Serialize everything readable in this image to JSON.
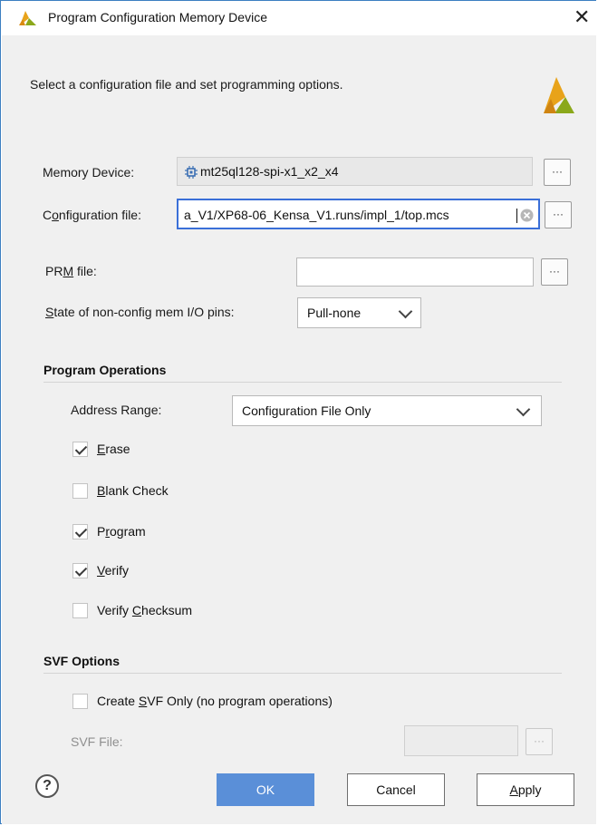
{
  "window": {
    "title": "Program Configuration Memory Device",
    "close_glyph": "✕"
  },
  "header": {
    "instruction": "Select a configuration file and set programming options."
  },
  "memory_device": {
    "label": "Memory Device:",
    "value": "mt25ql128-spi-x1_x2_x4",
    "browse_label": "···"
  },
  "config_file": {
    "label_prefix": "C",
    "label_underlined": "o",
    "label_suffix": "nfiguration file:",
    "value": "a_V1/XP68-06_Kensa_V1.runs/impl_1/top.mcs",
    "browse_label": "···"
  },
  "prm_file": {
    "label_prefix": "PR",
    "label_underlined": "M",
    "label_suffix": " file:",
    "value": "",
    "browse_label": "···"
  },
  "io_pins": {
    "label_prefix": "",
    "label_underlined": "S",
    "label_suffix": "tate of non-config mem I/O pins:",
    "selected": "Pull-none"
  },
  "program_operations": {
    "heading": "Program Operations",
    "address_range_label": "Address Range:",
    "address_range_selected": "Configuration File Only",
    "options": [
      {
        "prefix": "",
        "underlined": "E",
        "suffix": "rase",
        "checked": true
      },
      {
        "prefix": "",
        "underlined": "B",
        "suffix": "lank Check",
        "checked": false
      },
      {
        "prefix": "P",
        "underlined": "r",
        "suffix": "ogram",
        "checked": true
      },
      {
        "prefix": "",
        "underlined": "V",
        "suffix": "erify",
        "checked": true
      },
      {
        "prefix": "Verify ",
        "underlined": "C",
        "suffix": "hecksum",
        "checked": false
      }
    ]
  },
  "svf_options": {
    "heading": "SVF Options",
    "create_prefix": "Create ",
    "create_underlined": "S",
    "create_suffix": "VF Only (no program operations)",
    "create_checked": false,
    "svf_file_label": "SVF File:",
    "svf_file_value": "",
    "browse_label": "···"
  },
  "footer": {
    "help_glyph": "?",
    "ok_label": "OK",
    "cancel_label": "Cancel",
    "apply_prefix": "",
    "apply_underlined": "A",
    "apply_suffix": "pply"
  },
  "colors": {
    "accent_blue": "#3a6fd8",
    "primary_button": "#5a8fd8",
    "logo_gold": "#e8a31a",
    "logo_green": "#8ba81a"
  }
}
